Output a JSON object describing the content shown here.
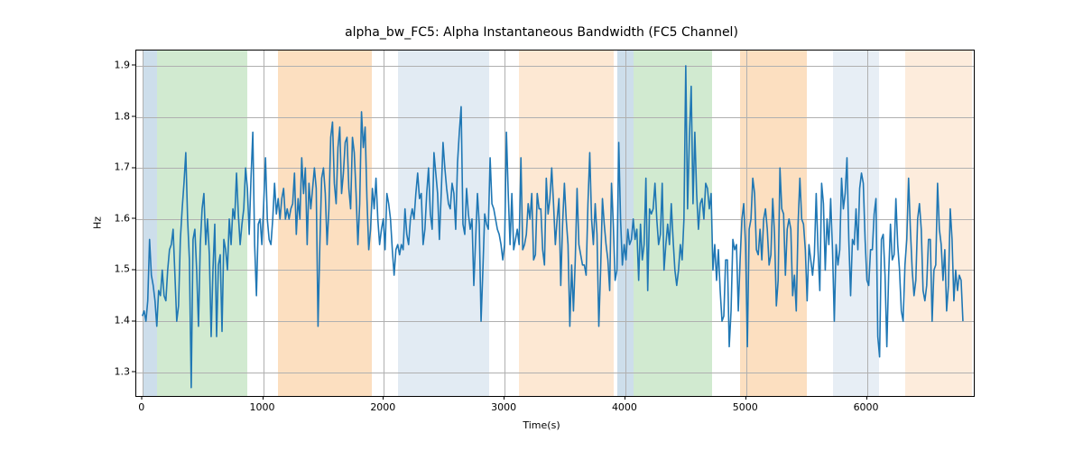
{
  "chart_data": {
    "type": "line",
    "title": "alpha_bw_FC5: Alpha Instantaneous Bandwidth (FC5 Channel)",
    "xlabel": "Time(s)",
    "ylabel": "Hz",
    "xlim": [
      -50,
      6900
    ],
    "ylim": [
      1.25,
      1.93
    ],
    "xticks": [
      0,
      1000,
      2000,
      3000,
      4000,
      5000,
      6000
    ],
    "yticks": [
      1.3,
      1.4,
      1.5,
      1.6,
      1.7,
      1.8,
      1.9
    ],
    "bands": [
      {
        "x0": 0,
        "x1": 120,
        "color": "#c4d8e8",
        "opacity": 0.85
      },
      {
        "x0": 120,
        "x1": 870,
        "color": "#c9e6c8",
        "opacity": 0.85
      },
      {
        "x0": 1120,
        "x1": 1900,
        "color": "#fcd9b5",
        "opacity": 0.85
      },
      {
        "x0": 2120,
        "x1": 2870,
        "color": "#dde7f1",
        "opacity": 0.85
      },
      {
        "x0": 3120,
        "x1": 3900,
        "color": "#fde4cb",
        "opacity": 0.85
      },
      {
        "x0": 3930,
        "x1": 4070,
        "color": "#c4d8e8",
        "opacity": 0.85
      },
      {
        "x0": 4070,
        "x1": 4720,
        "color": "#c9e6c8",
        "opacity": 0.85
      },
      {
        "x0": 4950,
        "x1": 5500,
        "color": "#fcd9b5",
        "opacity": 0.85
      },
      {
        "x0": 5720,
        "x1": 6100,
        "color": "#e3ebf3",
        "opacity": 0.85
      },
      {
        "x0": 6320,
        "x1": 6870,
        "color": "#fde9d6",
        "opacity": 0.85
      }
    ],
    "series": [
      {
        "name": "alpha_bw_FC5",
        "color": "#1f77b4",
        "x_step": 15,
        "x_start": 0,
        "y": [
          1.41,
          1.42,
          1.4,
          1.44,
          1.56,
          1.49,
          1.47,
          1.44,
          1.39,
          1.46,
          1.45,
          1.5,
          1.45,
          1.44,
          1.5,
          1.54,
          1.55,
          1.58,
          1.49,
          1.4,
          1.43,
          1.56,
          1.62,
          1.67,
          1.73,
          1.6,
          1.52,
          1.27,
          1.56,
          1.58,
          1.5,
          1.39,
          1.55,
          1.62,
          1.65,
          1.55,
          1.6,
          1.53,
          1.37,
          1.5,
          1.59,
          1.37,
          1.51,
          1.53,
          1.38,
          1.56,
          1.54,
          1.5,
          1.6,
          1.55,
          1.62,
          1.6,
          1.69,
          1.61,
          1.55,
          1.59,
          1.62,
          1.7,
          1.66,
          1.57,
          1.68,
          1.77,
          1.55,
          1.45,
          1.59,
          1.6,
          1.55,
          1.63,
          1.72,
          1.6,
          1.56,
          1.55,
          1.6,
          1.67,
          1.61,
          1.64,
          1.6,
          1.64,
          1.66,
          1.6,
          1.62,
          1.6,
          1.62,
          1.63,
          1.69,
          1.57,
          1.64,
          1.6,
          1.72,
          1.65,
          1.7,
          1.55,
          1.67,
          1.62,
          1.66,
          1.7,
          1.66,
          1.39,
          1.55,
          1.68,
          1.7,
          1.65,
          1.55,
          1.62,
          1.76,
          1.79,
          1.67,
          1.63,
          1.74,
          1.78,
          1.65,
          1.69,
          1.75,
          1.76,
          1.66,
          1.62,
          1.76,
          1.73,
          1.65,
          1.55,
          1.63,
          1.81,
          1.74,
          1.78,
          1.64,
          1.54,
          1.58,
          1.66,
          1.62,
          1.68,
          1.6,
          1.55,
          1.58,
          1.6,
          1.54,
          1.65,
          1.63,
          1.6,
          1.54,
          1.49,
          1.54,
          1.55,
          1.53,
          1.55,
          1.54,
          1.62,
          1.57,
          1.55,
          1.6,
          1.62,
          1.6,
          1.65,
          1.69,
          1.64,
          1.65,
          1.55,
          1.58,
          1.65,
          1.7,
          1.61,
          1.58,
          1.73,
          1.69,
          1.65,
          1.56,
          1.65,
          1.75,
          1.7,
          1.66,
          1.63,
          1.62,
          1.67,
          1.65,
          1.58,
          1.71,
          1.77,
          1.82,
          1.59,
          1.57,
          1.66,
          1.61,
          1.58,
          1.6,
          1.47,
          1.56,
          1.65,
          1.59,
          1.4,
          1.5,
          1.61,
          1.59,
          1.58,
          1.72,
          1.63,
          1.62,
          1.6,
          1.58,
          1.57,
          1.55,
          1.52,
          1.55,
          1.77,
          1.65,
          1.55,
          1.65,
          1.54,
          1.56,
          1.58,
          1.55,
          1.72,
          1.54,
          1.55,
          1.57,
          1.63,
          1.6,
          1.65,
          1.52,
          1.53,
          1.65,
          1.62,
          1.62,
          1.54,
          1.51,
          1.68,
          1.61,
          1.64,
          1.7,
          1.63,
          1.55,
          1.6,
          1.64,
          1.47,
          1.59,
          1.67,
          1.6,
          1.55,
          1.39,
          1.51,
          1.42,
          1.52,
          1.66,
          1.55,
          1.53,
          1.51,
          1.51,
          1.49,
          1.63,
          1.73,
          1.6,
          1.55,
          1.63,
          1.57,
          1.39,
          1.5,
          1.64,
          1.59,
          1.55,
          1.52,
          1.46,
          1.67,
          1.59,
          1.48,
          1.5,
          1.75,
          1.6,
          1.51,
          1.55,
          1.52,
          1.58,
          1.55,
          1.56,
          1.6,
          1.56,
          1.58,
          1.48,
          1.59,
          1.52,
          1.55,
          1.68,
          1.46,
          1.62,
          1.61,
          1.62,
          1.67,
          1.6,
          1.55,
          1.57,
          1.67,
          1.5,
          1.55,
          1.59,
          1.55,
          1.63,
          1.56,
          1.5,
          1.47,
          1.5,
          1.55,
          1.52,
          1.6,
          1.9,
          1.62,
          1.76,
          1.86,
          1.63,
          1.77,
          1.65,
          1.58,
          1.63,
          1.64,
          1.6,
          1.67,
          1.66,
          1.62,
          1.65,
          1.5,
          1.55,
          1.48,
          1.54,
          1.46,
          1.4,
          1.41,
          1.52,
          1.52,
          1.35,
          1.42,
          1.56,
          1.54,
          1.55,
          1.42,
          1.52,
          1.6,
          1.63,
          1.55,
          1.35,
          1.58,
          1.6,
          1.68,
          1.65,
          1.54,
          1.53,
          1.58,
          1.52,
          1.6,
          1.62,
          1.58,
          1.51,
          1.53,
          1.64,
          1.57,
          1.43,
          1.48,
          1.7,
          1.62,
          1.61,
          1.49,
          1.58,
          1.6,
          1.58,
          1.45,
          1.49,
          1.42,
          1.59,
          1.68,
          1.6,
          1.59,
          1.54,
          1.44,
          1.55,
          1.52,
          1.49,
          1.53,
          1.65,
          1.54,
          1.46,
          1.67,
          1.63,
          1.5,
          1.6,
          1.55,
          1.64,
          1.54,
          1.4,
          1.55,
          1.51,
          1.54,
          1.68,
          1.62,
          1.65,
          1.72,
          1.56,
          1.45,
          1.56,
          1.55,
          1.62,
          1.54,
          1.66,
          1.69,
          1.67,
          1.56,
          1.48,
          1.47,
          1.54,
          1.54,
          1.61,
          1.64,
          1.37,
          1.33,
          1.56,
          1.57,
          1.49,
          1.35,
          1.49,
          1.59,
          1.52,
          1.53,
          1.64,
          1.55,
          1.5,
          1.42,
          1.4,
          1.51,
          1.56,
          1.68,
          1.58,
          1.5,
          1.45,
          1.48,
          1.6,
          1.63,
          1.58,
          1.46,
          1.44,
          1.47,
          1.56,
          1.56,
          1.4,
          1.5,
          1.51,
          1.67,
          1.58,
          1.55,
          1.48,
          1.54,
          1.42,
          1.47,
          1.62,
          1.56,
          1.44,
          1.5,
          1.46,
          1.49,
          1.48,
          1.4
        ]
      }
    ]
  }
}
